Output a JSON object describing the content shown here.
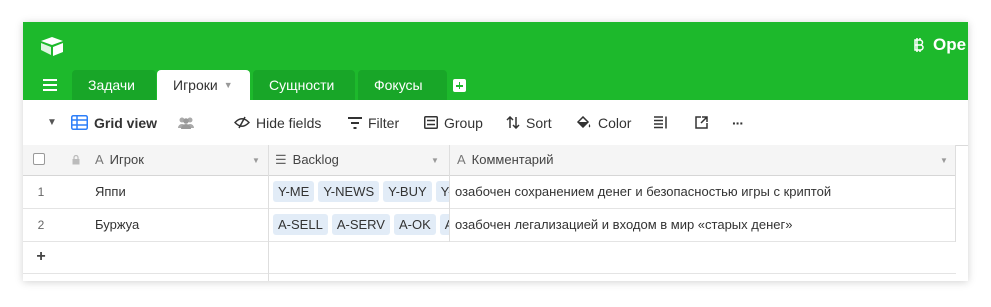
{
  "header": {
    "base_title": "Оре",
    "brand_color": "#1db92c"
  },
  "tabs": [
    {
      "label": "Задачи"
    },
    {
      "label": "Игроки",
      "active": true
    },
    {
      "label": "Сущности"
    },
    {
      "label": "Фокусы"
    }
  ],
  "toolbar": {
    "view_name": "Grid view",
    "hide_fields": "Hide fields",
    "filter": "Filter",
    "group": "Group",
    "sort": "Sort",
    "color": "Color",
    "more": "···"
  },
  "table": {
    "columns": [
      {
        "name": "Игрок",
        "type_icon": "text-icon"
      },
      {
        "name": "Backlog",
        "type_icon": "linked-records-icon"
      },
      {
        "name": "Комментарий",
        "type_icon": "text-icon"
      }
    ],
    "rows": [
      {
        "num": "1",
        "player": "Яппи",
        "backlog": [
          "Y-ME",
          "Y-NEWS",
          "Y-BUY",
          "Y-"
        ],
        "comment": "озабочен сохранением денег и безопасностью игры с криптой"
      },
      {
        "num": "2",
        "player": "Буржуа",
        "backlog": [
          "A-SELL",
          "A-SERV",
          "A-OK",
          "A"
        ],
        "comment": "озабочен легализацией и входом в мир «старых денег»"
      }
    ],
    "add_row": "+"
  }
}
